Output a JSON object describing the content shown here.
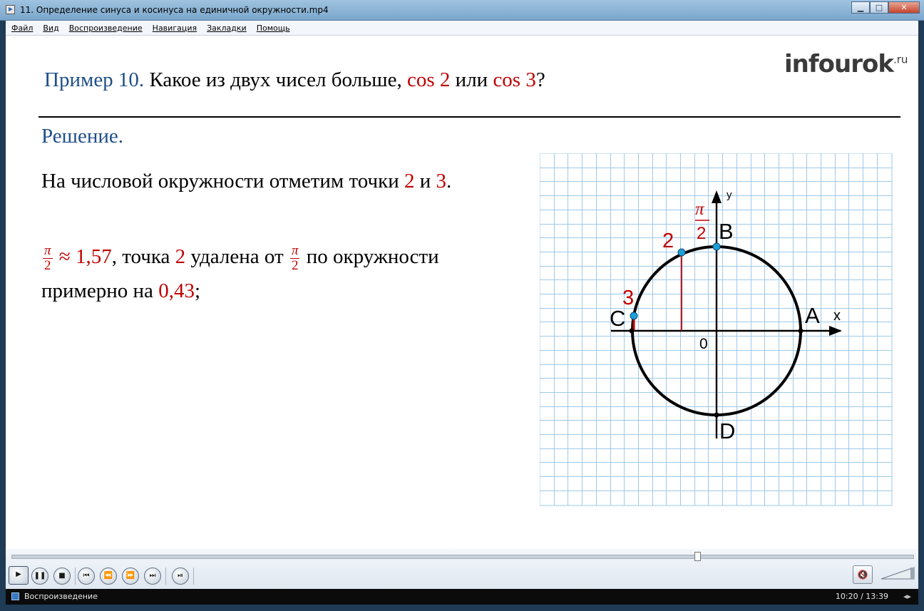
{
  "window": {
    "title": "11. Определение синуса и косинуса на единичной окружности.mp4",
    "minimize_glyph": "▁",
    "maximize_glyph": "□",
    "close_glyph": "✕"
  },
  "menu": [
    "Файл",
    "Вид",
    "Воспроизведение",
    "Навигация",
    "Закладки",
    "Помощь"
  ],
  "slide": {
    "heading_prefix": "Пример 10.",
    "heading_text": " Какое из двух чисел больше, ",
    "cos2": "cos 2",
    "or_text": " или ",
    "cos3": "cos 3",
    "question_mark": "?",
    "logo_main": "infourok",
    "logo_suffix": ".ru",
    "solution": "Решение.",
    "para1_text": "На числовой окружности отметим точки ",
    "para1_num2": "2",
    "para1_and": " и ",
    "para1_num3": "3",
    "para1_end": ".",
    "pi": "π",
    "two": "2",
    "para2_approx": "≈ 1,57",
    "para2_point": ", точка ",
    "para2_num2": "2",
    "para2_removed": " удалена от ",
    "para2_along": " по окружности",
    "para2_roughly": "примерно на ",
    "para2_value": "0,43",
    "para2_end": ";"
  },
  "diagram": {
    "axis_x": "x",
    "axis_y": "y",
    "origin": "0",
    "label_A": "A",
    "label_B": "B",
    "label_C": "C",
    "label_D": "D",
    "label_2": "2",
    "label_3": "3",
    "label_pi": "π",
    "label_pi_den": "2",
    "colors": {
      "grid": "#9ec9e8",
      "accent": "#c00000",
      "point": "#1e9fd8"
    }
  },
  "player": {
    "progress": 0.76,
    "buttons": [
      "play",
      "pause",
      "stop",
      "prev",
      "rewind",
      "forward",
      "next",
      "frame-step"
    ],
    "mute_glyph": "🔇",
    "status": "Воспроизведение",
    "time": "10:20 / 13:39",
    "grip": "◂▸"
  }
}
